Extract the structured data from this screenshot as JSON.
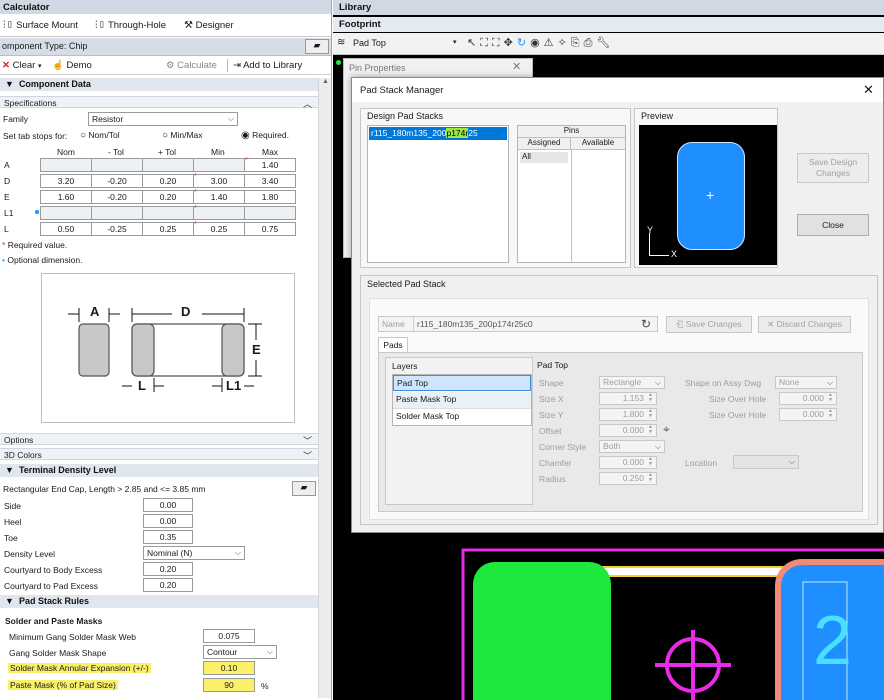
{
  "left": {
    "panel_title": "Calculator",
    "tabs": [
      {
        "label": "Surface Mount"
      },
      {
        "label": "Through-Hole"
      },
      {
        "label": "Designer"
      }
    ],
    "component_type": "omponent Type: Chip",
    "toolbar": {
      "clear": "Clear",
      "demo": "Demo",
      "calculate": "Calculate",
      "add_to_library": "Add to Library"
    },
    "component_data": {
      "title": "Component Data",
      "specifications": "Specifications",
      "family_label": "Family",
      "family_value": "Resistor",
      "tab_stops_label": "Set tab stops for:",
      "tab_stops": [
        {
          "label": "Nom/Tol",
          "checked": false
        },
        {
          "label": "Min/Max",
          "checked": false
        },
        {
          "label": "Required.",
          "checked": true
        }
      ],
      "columns": [
        "Nom",
        "- Tol",
        "+ Tol",
        "Min",
        "Max"
      ],
      "rows": [
        {
          "name": "A",
          "values": [
            "",
            "",
            "",
            "",
            "1.40"
          ]
        },
        {
          "name": "D",
          "values": [
            "3.20",
            "-0.20",
            "0.20",
            "3.00",
            "3.40"
          ]
        },
        {
          "name": "E",
          "values": [
            "1.60",
            "-0.20",
            "0.20",
            "1.40",
            "1.80"
          ]
        },
        {
          "name": "L1",
          "values": [
            "",
            "",
            "",
            "",
            ""
          ]
        },
        {
          "name": "L",
          "values": [
            "0.50",
            "-0.25",
            "0.25",
            "0.25",
            "0.75"
          ]
        }
      ],
      "required_note": "Required value.",
      "optional_note": "Optional dimension.",
      "diagram_labels": {
        "a": "A",
        "d": "D",
        "e": "E",
        "l": "L",
        "l1": "L1"
      }
    },
    "options": "Options",
    "colors_3d": "3D Colors",
    "terminal_density": {
      "title": "Terminal Density Level",
      "description": "Rectangular End Cap, Length > 2.85 and <= 3.85 mm",
      "fields": [
        {
          "label": "Side",
          "value": "0.00"
        },
        {
          "label": "Heel",
          "value": "0.00"
        },
        {
          "label": "Toe",
          "value": "0.35"
        }
      ],
      "density_label": "Density Level",
      "density_value": "Nominal (N)",
      "excess": [
        {
          "label": "Courtyard to Body Excess",
          "value": "0.20"
        },
        {
          "label": "Courtyard to Pad Excess",
          "value": "0.20"
        }
      ]
    },
    "pad_stack_rules": {
      "title": "Pad Stack Rules",
      "subtitle": "Solder and Paste Masks",
      "min_gang_label": "Minimum Gang Solder Mask Web",
      "min_gang_value": "0.075",
      "gang_shape_label": "Gang Solder Mask Shape",
      "gang_shape_value": "Contour",
      "annular_label": "Solder Mask Annular Expansion (+/-)",
      "annular_value": "0.10",
      "paste_label": "Paste Mask (% of Pad Size)",
      "paste_value": "90",
      "paste_unit": "%"
    }
  },
  "right": {
    "library_title": "Library",
    "footprint_title": "Footprint",
    "layer_select": "Pad Top",
    "pin_properties": "Pin Properties",
    "pin_number": "2"
  },
  "dialog": {
    "title": "Pad Stack Manager",
    "design_pad_stacks": "Design Pad Stacks",
    "stack_item_pre": "r115_180m135_200",
    "stack_item_hl": "p174r",
    "stack_item_post": "25",
    "pins_header": "Pins",
    "assigned": "Assigned",
    "available": "Available",
    "assigned_item": "All",
    "preview": "Preview",
    "preview_y": "Y",
    "preview_x": "X",
    "save_design_changes": "Save Design Changes",
    "close": "Close",
    "selected_pad_stack": "Selected Pad Stack",
    "name_label": "Name",
    "name_value": "r115_180m135_200p174r25c0",
    "save_changes": "Save Changes",
    "discard_changes": "Discard Changes",
    "pads_tab": "Pads",
    "layers_title": "Layers",
    "layers": [
      "Pad Top",
      "Paste Mask Top",
      "Solder Mask Top"
    ],
    "pad_top_title": "Pad Top",
    "shape_label": "Shape",
    "shape_value": "Rectangle",
    "sizex_label": "Size X",
    "sizex_value": "1.153",
    "sizey_label": "Size Y",
    "sizey_value": "1.800",
    "offset_label": "Offset",
    "offset_value": "0.000",
    "corner_label": "Corner Style",
    "corner_value": "Both",
    "chamfer_label": "Chamfer",
    "chamfer_value": "0.000",
    "radius_label": "Radius",
    "radius_value": "0.250",
    "assy_label": "Shape on Assy Dwg",
    "assy_value": "None",
    "hole_x_label": "Size Over Hole",
    "hole_x_value": "0.000",
    "hole_y_label": "Size Over Hole",
    "hole_y_value": "0.000",
    "location_label": "Location"
  },
  "colors": {
    "pad_blue": "#1f8fff",
    "pad_green": "#1ee83c",
    "magenta": "#e62ce6",
    "pad_salmon": "#f28a7a"
  }
}
